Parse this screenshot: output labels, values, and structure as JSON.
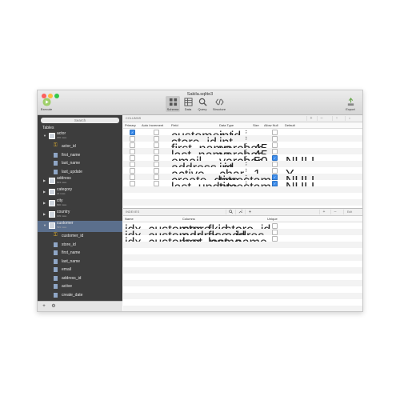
{
  "window": {
    "title": "Sakila.sqlite3"
  },
  "toolbar": {
    "execute_label": "Execute",
    "schema_label": "Schema",
    "data_label": "Data",
    "query_label": "Query",
    "structure_label": "Structure",
    "export_label": "Export"
  },
  "sidebar": {
    "search_placeholder": "Search",
    "tables_label": "Tables",
    "items": [
      {
        "kind": "table",
        "name": "actor",
        "rows": "200 rows",
        "open": true
      },
      {
        "kind": "key",
        "name": "actor_id"
      },
      {
        "kind": "col",
        "name": "first_name"
      },
      {
        "kind": "col",
        "name": "last_name"
      },
      {
        "kind": "col",
        "name": "last_update"
      },
      {
        "kind": "table",
        "name": "address",
        "rows": "603 rows",
        "open": false
      },
      {
        "kind": "table",
        "name": "category",
        "rows": "16 rows",
        "open": false
      },
      {
        "kind": "table",
        "name": "city",
        "rows": "600 rows",
        "open": false
      },
      {
        "kind": "table",
        "name": "country",
        "rows": "109 rows",
        "open": false
      },
      {
        "kind": "table",
        "name": "customer",
        "rows": "599 rows",
        "open": true,
        "selected": true
      },
      {
        "kind": "key",
        "name": "customer_id"
      },
      {
        "kind": "col",
        "name": "store_id"
      },
      {
        "kind": "col",
        "name": "first_name"
      },
      {
        "kind": "col",
        "name": "last_name"
      },
      {
        "kind": "col",
        "name": "email"
      },
      {
        "kind": "col",
        "name": "address_id"
      },
      {
        "kind": "col",
        "name": "active"
      },
      {
        "kind": "col",
        "name": "create_date"
      }
    ]
  },
  "columns_section": {
    "label": "COLUMNS",
    "headers": {
      "primary": "Primary",
      "auto": "Auto Increment",
      "field": "Field",
      "type": "Data Type",
      "size": "Size",
      "allow_null": "Allow Null",
      "default": "Default"
    },
    "rows": [
      {
        "primary": true,
        "field": "customer_id",
        "type": "int",
        "size": "",
        "null": false,
        "default": ""
      },
      {
        "primary": false,
        "field": "store_id",
        "type": "int",
        "size": "",
        "null": false,
        "default": ""
      },
      {
        "primary": false,
        "field": "first_name",
        "type": "varchar",
        "size": "45",
        "null": false,
        "default": ""
      },
      {
        "primary": false,
        "field": "last_name",
        "type": "varchar",
        "size": "45",
        "null": false,
        "default": ""
      },
      {
        "primary": false,
        "field": "email",
        "type": "varchar",
        "size": "50",
        "null": true,
        "default": "NULL"
      },
      {
        "primary": false,
        "field": "address_id",
        "type": "int",
        "size": "",
        "null": false,
        "default": ""
      },
      {
        "primary": false,
        "field": "active",
        "type": "char",
        "size": "1",
        "null": false,
        "default": "Y"
      },
      {
        "primary": false,
        "field": "create_date",
        "type": "timestamp",
        "size": "",
        "null": true,
        "default": "NULL"
      },
      {
        "primary": false,
        "field": "last_update",
        "type": "timestamp",
        "size": "",
        "null": true,
        "default": "NULL"
      }
    ]
  },
  "indexes_section": {
    "label": "INDEXES",
    "edit_label": "Edit",
    "headers": {
      "name": "Name",
      "columns": "Columns",
      "unique": "Unique"
    },
    "rows": [
      {
        "name": "idx_customer_fk_store_id",
        "columns": "store_id"
      },
      {
        "name": "idx_customer_fk_addres...",
        "columns": "address_id"
      },
      {
        "name": "idx_customer_last_name",
        "columns": "last_name"
      }
    ]
  },
  "colors": {
    "sidebar_bg": "#3d3d3d",
    "selection": "#5b6f8c",
    "checkbox_on": "#3b8bea"
  }
}
